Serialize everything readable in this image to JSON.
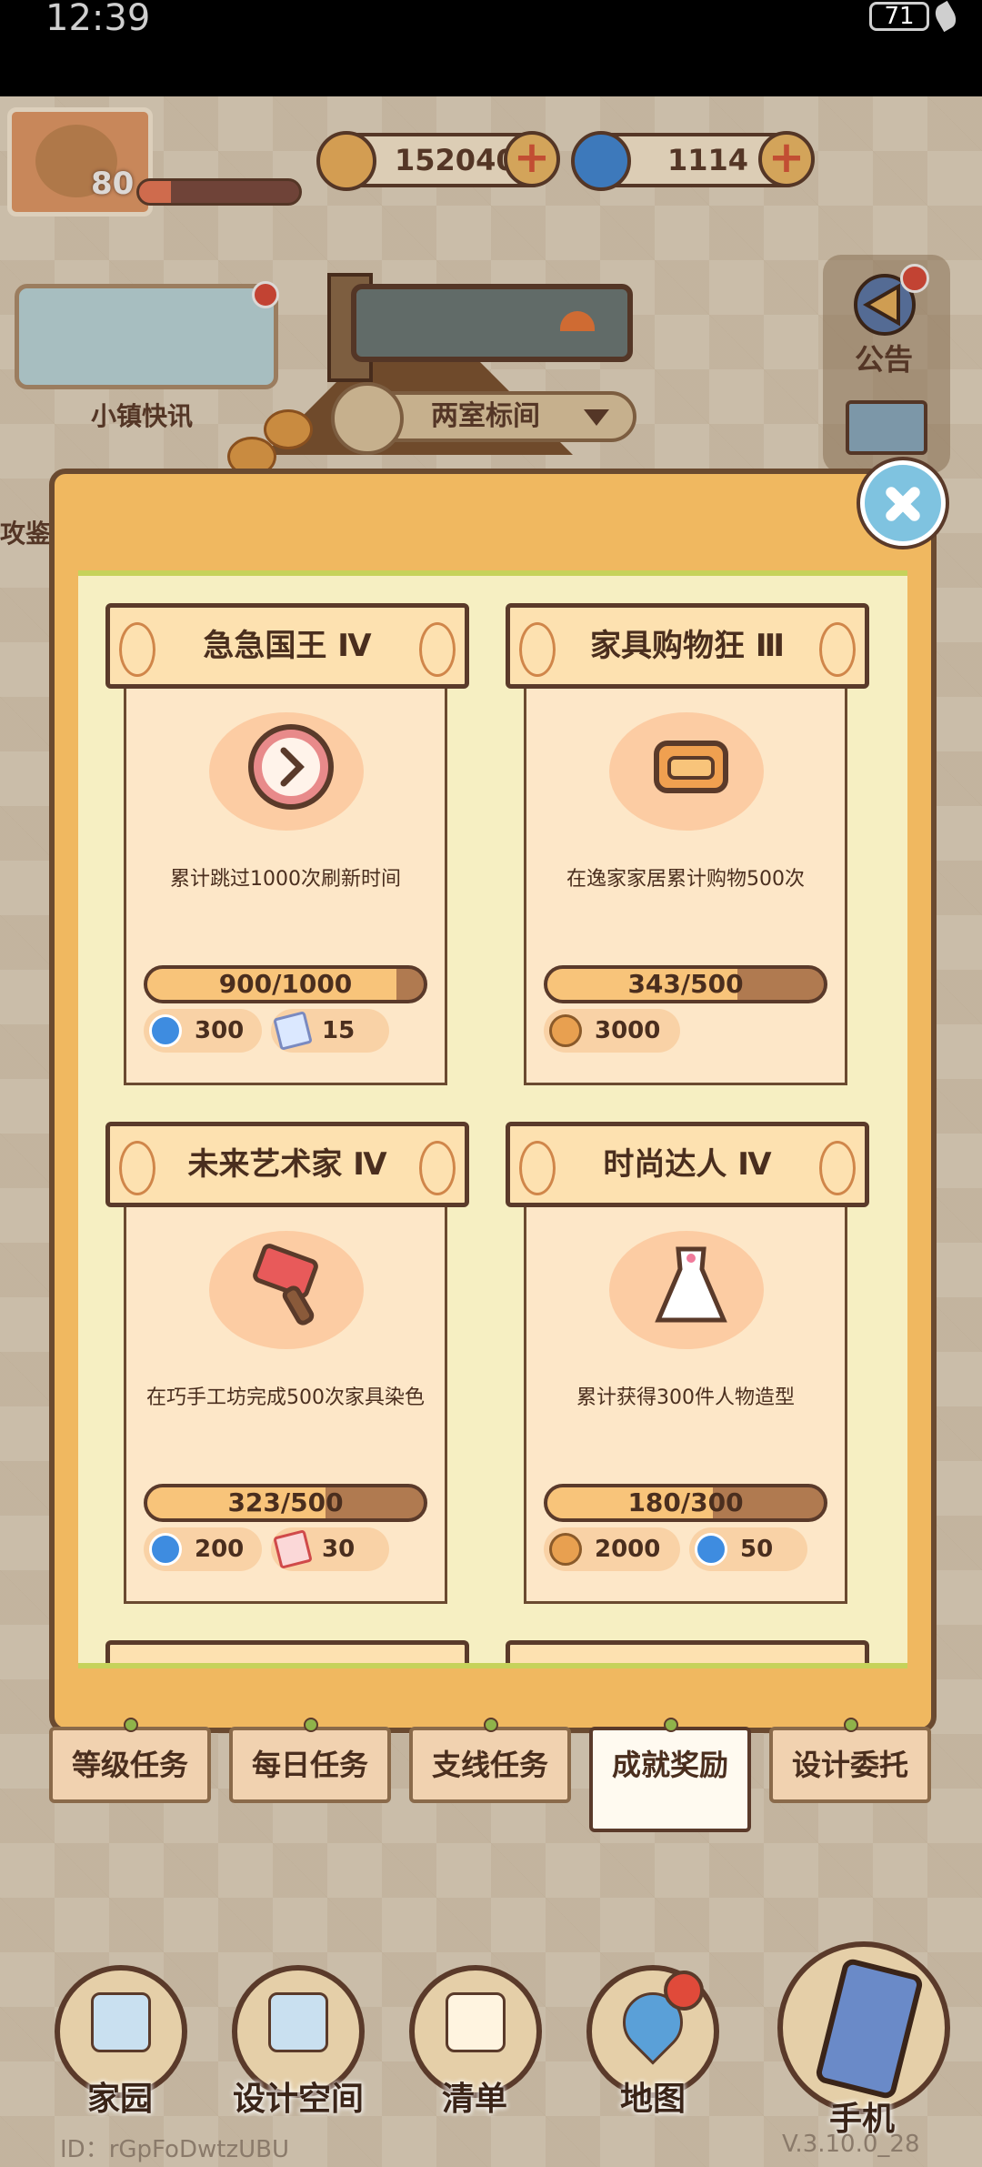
{
  "status_bar": {
    "time": "12:39",
    "battery": "71"
  },
  "hud": {
    "level": "80",
    "xp_fraction": 0.2,
    "coins": "152040",
    "swirls": "1114",
    "news_label": "小镇快讯",
    "room_selector": "两室标间",
    "announcement_label": "公告",
    "left_cut_text": "攻鉴"
  },
  "cards": [
    {
      "title": "急急国王 Ⅳ",
      "desc": "累计跳过1000次刷新时间",
      "progress_text": "900/1000",
      "progress": 0.9,
      "icon": "clock-icon",
      "rewards": [
        {
          "icon": "swirl-icon",
          "value": "300"
        },
        {
          "icon": "ticket-icon",
          "value": "15"
        }
      ]
    },
    {
      "title": "家具购物狂 Ⅲ",
      "desc": "在逸家家居累计购物500次",
      "progress_text": "343/500",
      "progress": 0.686,
      "icon": "sofa-icon",
      "rewards": [
        {
          "icon": "coin-icon",
          "value": "3000"
        }
      ]
    },
    {
      "title": "未来艺术家 Ⅳ",
      "desc": "在巧手工坊完成500次家具染色",
      "progress_text": "323/500",
      "progress": 0.646,
      "icon": "paint-brush-icon",
      "rewards": [
        {
          "icon": "swirl-icon",
          "value": "200"
        },
        {
          "icon": "ticket-red-icon",
          "value": "30"
        }
      ]
    },
    {
      "title": "时尚达人 Ⅳ",
      "desc": "累计获得300件人物造型",
      "progress_text": "180/300",
      "progress": 0.6,
      "icon": "dress-icon",
      "rewards": [
        {
          "icon": "coin-icon",
          "value": "2000"
        },
        {
          "icon": "swirl-icon",
          "value": "50"
        }
      ]
    }
  ],
  "tabs": [
    "等级任务",
    "每日任务",
    "支线任务",
    "成就奖励",
    "设计委托"
  ],
  "active_tab": "成就奖励",
  "bottom_nav": [
    "家园",
    "设计空间",
    "清单",
    "地图",
    "手机"
  ],
  "footer": {
    "id": "ID：rGpFoDwtzUBU",
    "version": "V.3.10.0_28"
  }
}
